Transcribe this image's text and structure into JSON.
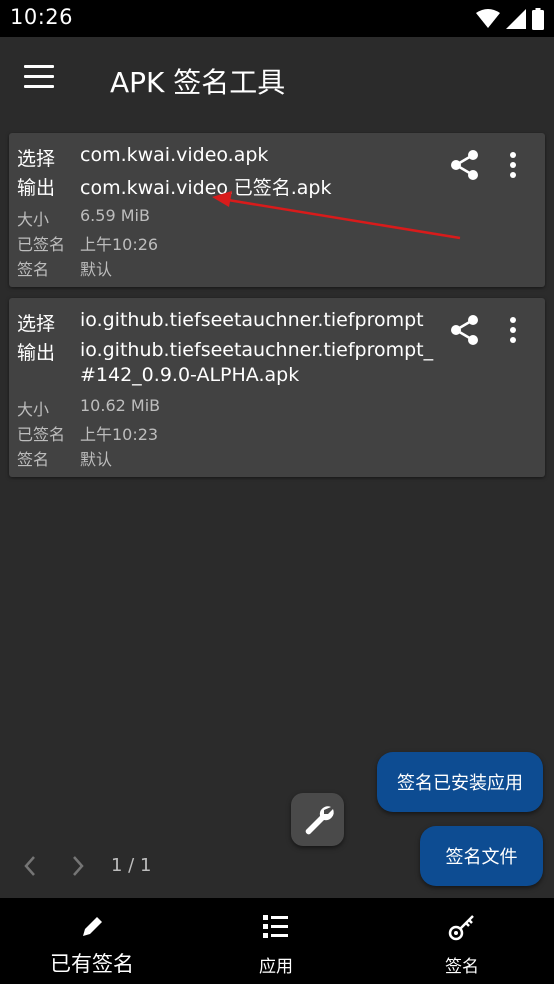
{
  "status_bar": {
    "time": "10:26"
  },
  "app_bar": {
    "title": "APK 签名工具"
  },
  "labels": {
    "select": "选择",
    "output": "输出",
    "size": "大小",
    "signed": "已签名",
    "signature": "签名"
  },
  "cards": [
    {
      "select": "com.kwai.video.apk",
      "output": "com.kwai.video.已签名.apk",
      "size": "6.59 MiB",
      "signed_time": "上午10:26",
      "signature": "默认"
    },
    {
      "select": "io.github.tiefseetauchner.tiefprompt",
      "output": "io.github.tiefseetauchner.tiefprompt_#142_0.9.0-ALPHA.apk",
      "size": "10.62 MiB",
      "signed_time": "上午10:23",
      "signature": "默认"
    }
  ],
  "fabs": {
    "sign_installed": "签名已安装应用",
    "sign_file": "签名文件"
  },
  "pager": {
    "text": "1 / 1"
  },
  "bottom_nav": [
    {
      "label": "已有签名",
      "icon": "pencil-icon",
      "active": true
    },
    {
      "label": "应用",
      "icon": "list-icon",
      "active": false
    },
    {
      "label": "签名",
      "icon": "key-icon",
      "active": false
    }
  ],
  "colors": {
    "background": "#2b2b2b",
    "card": "#424242",
    "fab": "#0d4c92",
    "annotation_arrow": "#d81b1b"
  }
}
